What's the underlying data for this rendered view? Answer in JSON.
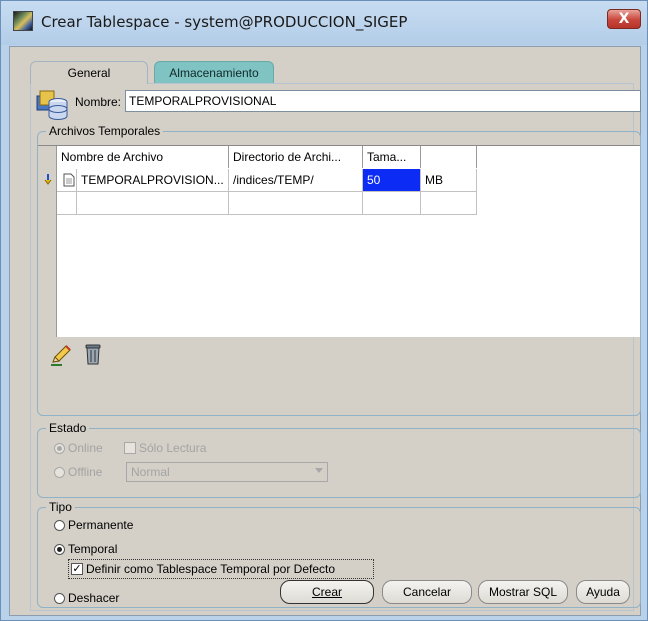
{
  "window": {
    "title": "Crear Tablespace - system@PRODUCCION_SIGEP",
    "close_glyph": "X"
  },
  "tabs": [
    {
      "label": "General",
      "active": true
    },
    {
      "label": "Almacenamiento",
      "active": false
    }
  ],
  "general": {
    "name_label": "Nombre:",
    "name_value": "TEMPORALPROVISIONAL"
  },
  "archivos": {
    "legend": "Archivos Temporales",
    "columns": [
      "Nombre de Archivo",
      "Directorio de Archi...",
      "Tama...",
      ""
    ],
    "rows": [
      {
        "nombre": "TEMPORALPROVISION...",
        "directorio": "/indices/TEMP/",
        "tamano": "50",
        "unidad": "MB"
      }
    ],
    "toolbar": {
      "edit_icon": "pencil-icon",
      "delete_icon": "trash-icon"
    }
  },
  "estado": {
    "legend": "Estado",
    "online_label": "Online",
    "readonly_label": "Sólo Lectura",
    "offline_label": "Offline",
    "offline_mode": "Normal"
  },
  "tipo": {
    "legend": "Tipo",
    "permanente_label": "Permanente",
    "temporal_label": "Temporal",
    "default_temp_label": "Definir como Tablespace Temporal por Defecto",
    "deshacer_label": "Deshacer"
  },
  "buttons": {
    "crear": "Crear",
    "cancelar": "Cancelar",
    "mostrar_sql": "Mostrar SQL",
    "ayuda": "Ayuda"
  },
  "colors": {
    "selection": "#0c2cf5",
    "tab_inactive": "#7fc3c2",
    "window_frame": "#b9d2ea"
  }
}
